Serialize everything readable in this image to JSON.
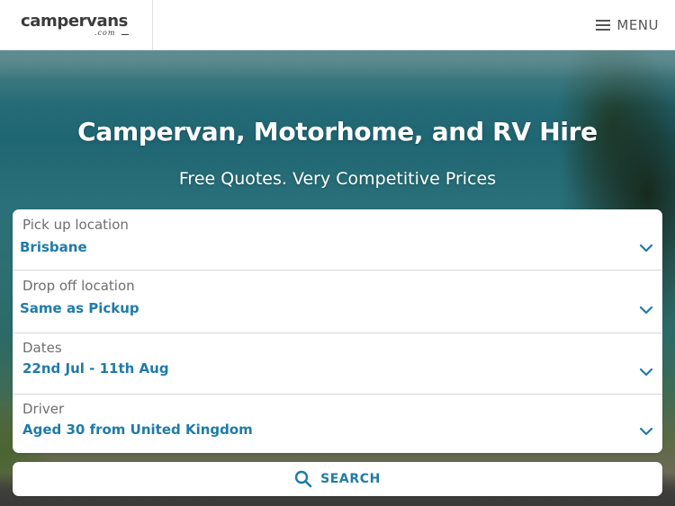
{
  "header": {
    "logo_text": "campervans",
    "logo_sub": ".com",
    "menu_label": "MENU"
  },
  "hero": {
    "title": "Campervan, Motorhome, and RV Hire",
    "subtitle": "Free Quotes. Very Competitive Prices"
  },
  "form": {
    "fields": [
      {
        "label": "Pick up location",
        "value": "Brisbane"
      },
      {
        "label": "Drop off location",
        "value": "Same as Pickup"
      },
      {
        "label": "Dates",
        "value": "22nd Jul - 11th Aug"
      },
      {
        "label": "Driver",
        "value": "Aged 30 from United Kingdom"
      }
    ],
    "search_label": "SEARCH"
  },
  "colors": {
    "accent": "#1f7ba8",
    "label_grey": "#6e6e6e",
    "logo_dark": "#3b3b3b"
  },
  "icons": {
    "menu": "hamburger-icon",
    "dropdown": "chevron-down-icon",
    "search": "search-icon"
  }
}
